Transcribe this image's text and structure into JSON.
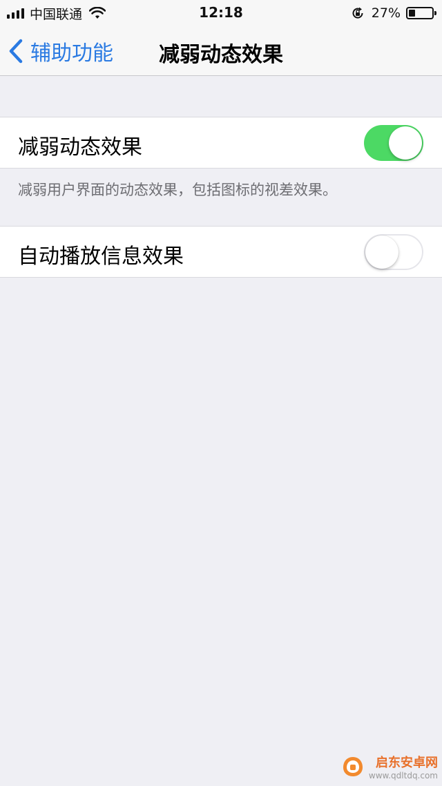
{
  "status_bar": {
    "carrier": "中国联通",
    "time": "12:18",
    "battery_percent": "27%",
    "battery_level": 0.27,
    "icons": [
      "signal-icon",
      "wifi-icon",
      "rotation-lock-icon",
      "battery-icon"
    ]
  },
  "nav": {
    "back_label": "辅助功能",
    "title": "减弱动态效果",
    "accent_color": "#2a7ae2"
  },
  "settings": [
    {
      "label": "减弱动态效果",
      "toggle_on": true
    },
    {
      "label": "自动播放信息效果",
      "toggle_on": false
    }
  ],
  "footnote": "减弱用户界面的动态效果，包括图标的视差效果。",
  "colors": {
    "toggle_on": "#4cd964",
    "background": "#efeff4"
  },
  "watermark": {
    "title": "启东安卓网",
    "url": "www.qdltdq.com"
  }
}
